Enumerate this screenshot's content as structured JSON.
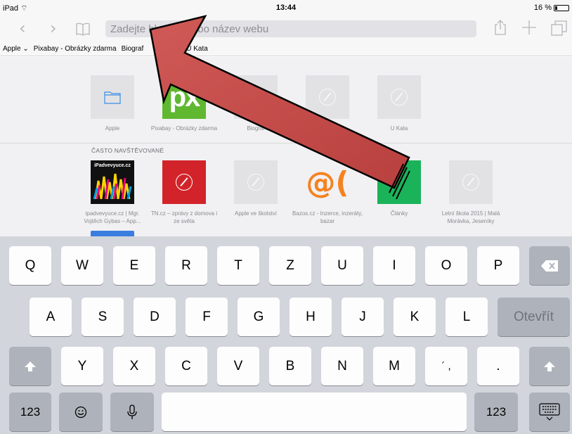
{
  "status": {
    "device": "iPad",
    "time": "13:44",
    "battery": "16 %"
  },
  "toolbar": {
    "back_icon": "chevron-left-icon",
    "forward_icon": "chevron-right-icon",
    "bookmarks_icon": "book-icon",
    "url_placeholder": "Zadejte hledání nebo název webu",
    "share_icon": "share-icon",
    "add_icon": "plus-icon",
    "tabs_icon": "tabs-icon"
  },
  "favorites_bar": [
    "Apple",
    "Pixabay - Obrázky zdarma",
    "Biograf",
    "U Kata"
  ],
  "favorites": [
    {
      "label": "Apple",
      "icon": "folder-icon"
    },
    {
      "label": "Pixabay - Obrázky zdarma",
      "icon": "px-logo"
    },
    {
      "label": "Biograf",
      "icon": "compass-icon"
    },
    {
      "label": "",
      "icon": "compass-icon"
    },
    {
      "label": "U Kata",
      "icon": "compass-icon"
    }
  ],
  "frequent": {
    "title": "ČASTO NAVŠTĚVOVANÉ",
    "items": [
      {
        "label": "ipadvevyuce.cz | Mgr. Vojtěch Gybas – App...",
        "thumb": "iPadvevyuce.cz"
      },
      {
        "label": "TN.cz – zprávy z domova i ze světa",
        "thumb": ""
      },
      {
        "label": "Apple ve školství",
        "thumb": ""
      },
      {
        "label": "Bazos.cz - Inzerce, inzeráty, bazar",
        "thumb": "@("
      },
      {
        "label": "Články",
        "thumb": ""
      },
      {
        "label": "Letní škola 2015 | Malá Morávka, Jeseníky",
        "thumb": ""
      }
    ]
  },
  "keyboard": {
    "row1": [
      "Q",
      "W",
      "E",
      "R",
      "T",
      "Z",
      "U",
      "I",
      "O",
      "P"
    ],
    "row2": [
      "A",
      "S",
      "D",
      "F",
      "G",
      "H",
      "J",
      "K",
      "L"
    ],
    "return_label": "Otevřít",
    "row3": [
      "Y",
      "X",
      "C",
      "V",
      "B",
      "N",
      "M"
    ],
    "punct": "´ ,",
    "dot": ".",
    "numbers_label": "123",
    "delete_icon": "backspace-icon",
    "shift_icon": "shift-icon",
    "emoji_icon": "emoji-icon",
    "mic_icon": "microphone-icon",
    "hide_icon": "keyboard-hide-icon"
  },
  "colors": {
    "arrow_fill": "#c8514f",
    "px_green": "#5fb830",
    "tn_red": "#d2232a",
    "bazos_orange": "#f58220",
    "clanky_green": "#1bb35a",
    "google_blue": "#3a7de0"
  }
}
